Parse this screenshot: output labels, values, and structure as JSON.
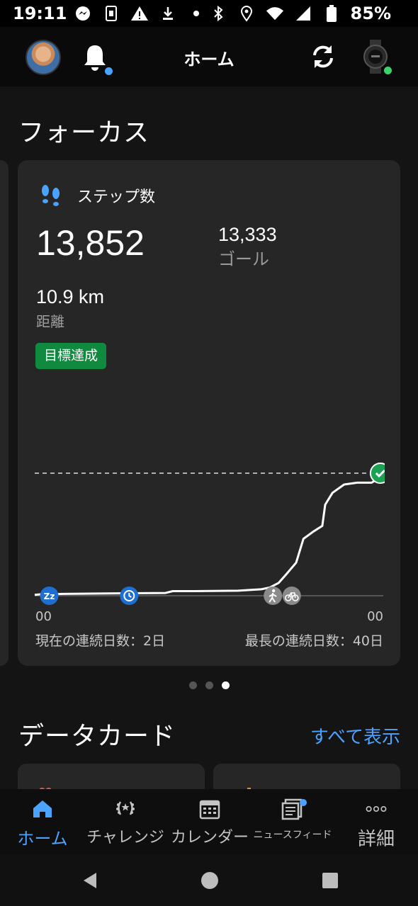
{
  "status_bar": {
    "time": "19:11",
    "battery": "85%",
    "left_icons": [
      "messenger-icon",
      "sim-icon",
      "warning-icon",
      "download-icon",
      "dot-icon"
    ],
    "right_icons": [
      "bluetooth-icon",
      "location-icon",
      "wifi-icon",
      "signal-icon",
      "battery-icon"
    ]
  },
  "header": {
    "title": "ホーム",
    "notification_dot_color": "#4aa3ff",
    "device_status_color": "#3dd36b"
  },
  "focus": {
    "section_title": "フォーカス",
    "card": {
      "title": "ステップ数",
      "steps": "13,852",
      "goal_value": "13,333",
      "goal_label": "ゴール",
      "distance": "10.9 km",
      "distance_label": "距離",
      "badge": "目標達成",
      "badge_color": "#108a3f",
      "axis_start": "00",
      "axis_end": "00",
      "streak_current": "現在の連続日数：2日",
      "streak_best": "最長の連続日数：40日"
    },
    "pagination": {
      "count": 3,
      "active": 3
    }
  },
  "chart_data": {
    "type": "line",
    "title": "",
    "xlabel": "",
    "ylabel": "",
    "x_range_hours": [
      0,
      24
    ],
    "y_range": [
      0,
      14500
    ],
    "goal": 13333,
    "goal_line": "dashed",
    "series": [
      {
        "x": [
          0,
          0.3,
          2,
          5,
          9,
          9.5,
          11,
          14,
          15.6,
          16.2,
          16.8,
          17.3,
          18,
          18.5,
          19.2,
          19.8,
          20,
          20.5,
          21.3,
          22.2,
          23.2,
          23.5,
          23.8
        ],
        "y": [
          100,
          150,
          200,
          250,
          300,
          500,
          500,
          550,
          700,
          900,
          1400,
          2300,
          3600,
          6200,
          7000,
          7600,
          9900,
          11200,
          12100,
          12300,
          12300,
          12600,
          13852
        ]
      }
    ],
    "markers": [
      {
        "hour": 1,
        "icon": "sleep-icon"
      },
      {
        "hour": 6.5,
        "icon": "clock-icon"
      },
      {
        "hour": 16.4,
        "icon": "walk-icon"
      },
      {
        "hour": 17.7,
        "icon": "bike-icon"
      },
      {
        "hour": 23.8,
        "icon": "goal-check-icon"
      }
    ],
    "line_color": "#ffffff",
    "marker_color": "#1e6fd0",
    "goal_marker_color": "#1aa252"
  },
  "data_cards": {
    "title": "データカード",
    "see_all": "すべて表示"
  },
  "bottom_nav": {
    "items": [
      {
        "label": "ホーム",
        "icon": "home-icon",
        "active": true
      },
      {
        "label": "チャレンジ",
        "icon": "laurel-icon",
        "active": false
      },
      {
        "label": "カレンダー",
        "icon": "calendar-icon",
        "active": false
      },
      {
        "label": "ニュースフィード",
        "icon": "newsfeed-icon",
        "active": false
      },
      {
        "label": "詳細",
        "icon": "more-icon",
        "active": false
      }
    ],
    "active_color": "#4aa3ff"
  }
}
